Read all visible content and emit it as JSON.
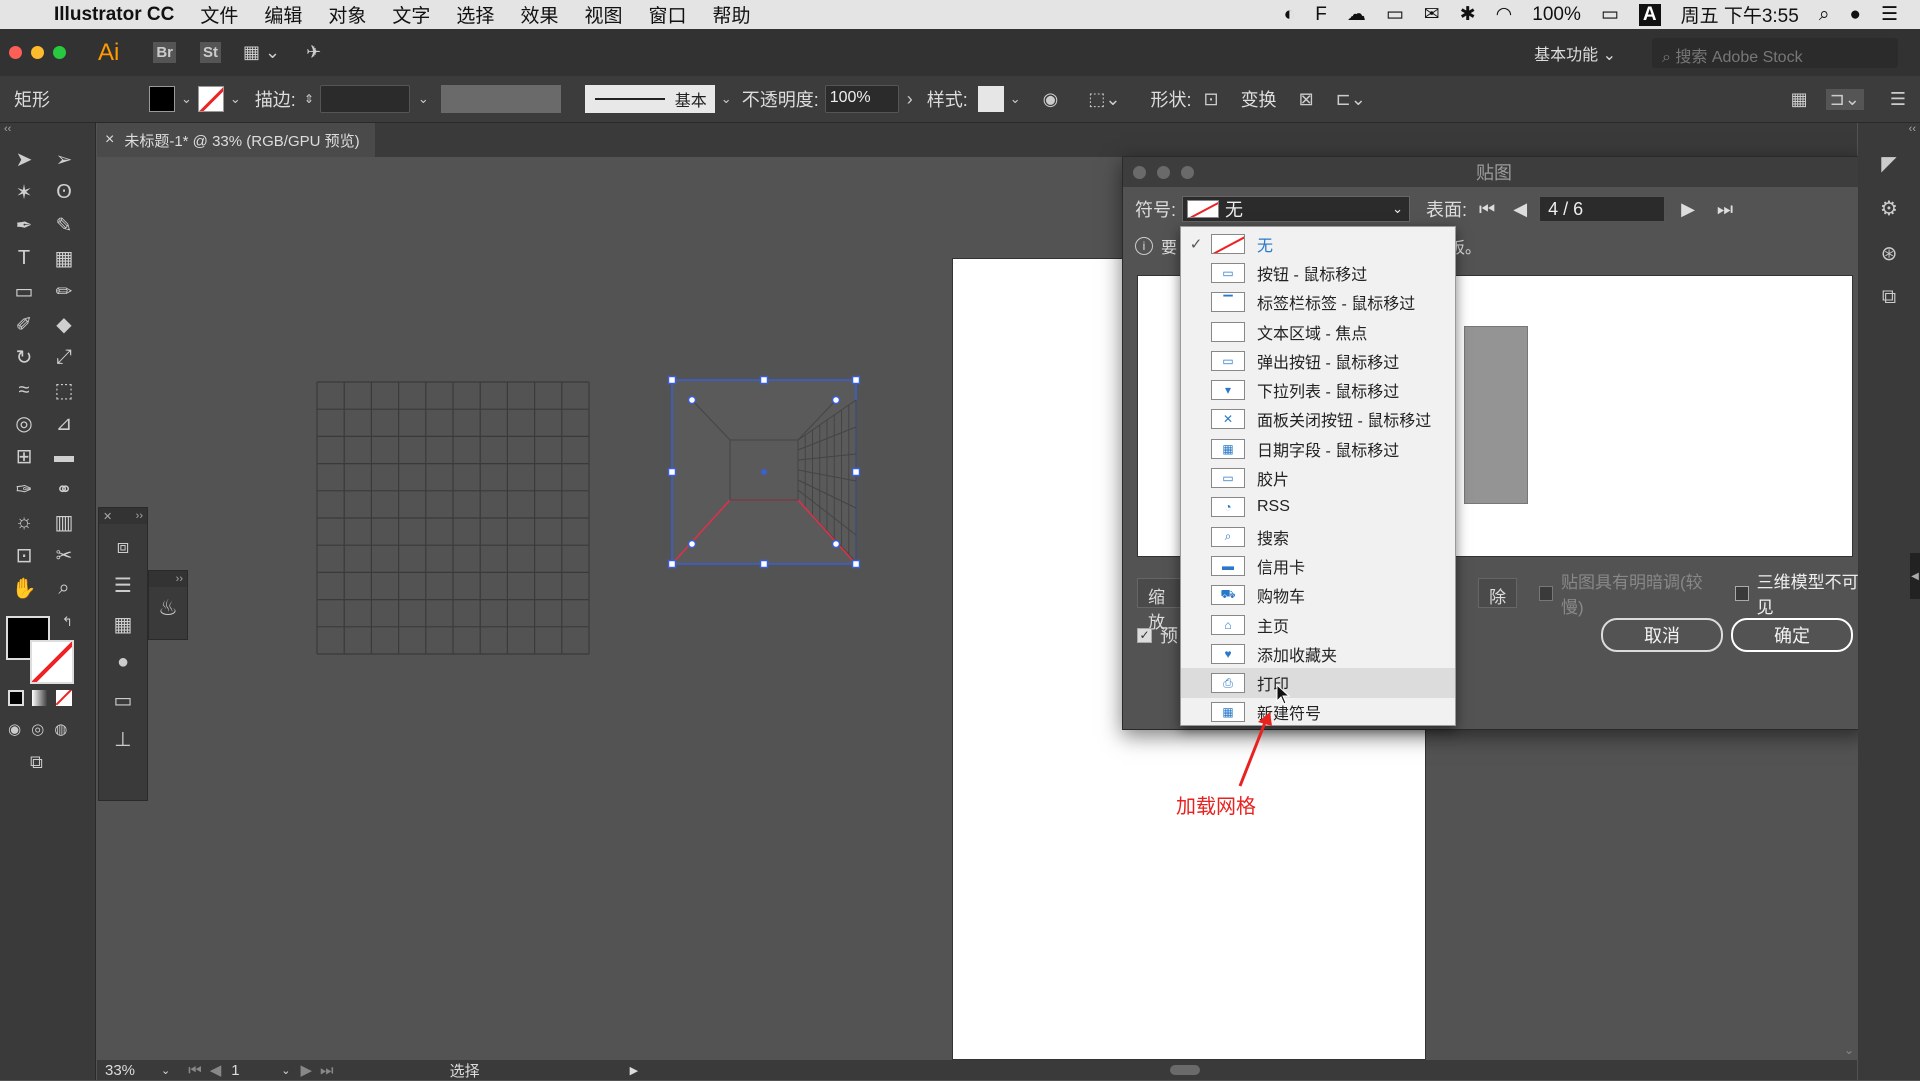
{
  "menubar": {
    "app_name": "Illustrator CC",
    "items": [
      "文件",
      "编辑",
      "对象",
      "文字",
      "选择",
      "效果",
      "视图",
      "窗口",
      "帮助"
    ],
    "battery": "100%",
    "input_method": "A",
    "datetime": "周五 下午3:55"
  },
  "appbar": {
    "logo": "Ai",
    "br": "Br",
    "st": "St",
    "workspace": "基本功能",
    "search_placeholder": "搜索 Adobe Stock"
  },
  "control": {
    "object_type": "矩形",
    "stroke_label": "描边:",
    "stroke_style": "基本",
    "opacity_label": "不透明度:",
    "opacity_value": "100%",
    "style_label": "样式:",
    "shape_label": "形状:",
    "transform_label": "变换"
  },
  "document_tab": {
    "title": "未标题-1* @ 33% (RGB/GPU 预览)",
    "close": "×"
  },
  "statusbar": {
    "zoom": "33%",
    "page": "1",
    "tool": "选择"
  },
  "dialog": {
    "title": "贴图",
    "symbol_label": "符号:",
    "symbol_value": "无",
    "surface_label": "表面:",
    "surface_value": "4 / 6",
    "info_left": "要",
    "info_right": "板。",
    "scale_btn": "缩放",
    "clear_btn": "除",
    "shade_checkbox": "贴图具有明暗调(较慢)",
    "invisible_checkbox": "三维模型不可见",
    "preview_checkbox": "预",
    "cancel": "取消",
    "ok": "确定"
  },
  "symbol_menu": {
    "items": [
      {
        "label": "无",
        "checked": true,
        "icon": "none-swatch-icon"
      },
      {
        "label": "按钮 - 鼠标移过",
        "icon": "button-icon"
      },
      {
        "label": "标签栏标签 - 鼠标移过",
        "icon": "tab-icon"
      },
      {
        "label": "文本区域 - 焦点",
        "icon": "textarea-icon"
      },
      {
        "label": "弹出按钮 - 鼠标移过",
        "icon": "popup-button-icon"
      },
      {
        "label": "下拉列表 - 鼠标移过",
        "icon": "dropdown-list-icon"
      },
      {
        "label": "面板关闭按钮 - 鼠标移过",
        "icon": "panel-close-icon"
      },
      {
        "label": "日期字段 - 鼠标移过",
        "icon": "date-field-icon"
      },
      {
        "label": "胶片",
        "icon": "film-icon"
      },
      {
        "label": "RSS",
        "icon": "rss-icon"
      },
      {
        "label": "搜索",
        "icon": "search-icon"
      },
      {
        "label": "信用卡",
        "icon": "credit-card-icon"
      },
      {
        "label": "购物车",
        "icon": "cart-icon"
      },
      {
        "label": "主页",
        "icon": "home-icon"
      },
      {
        "label": "添加收藏夹",
        "icon": "favorite-icon"
      },
      {
        "label": "打印",
        "icon": "print-icon",
        "highlighted": true
      },
      {
        "label": "新建符号",
        "icon": "new-symbol-icon"
      }
    ]
  },
  "annotation": {
    "text": "加载网格",
    "color": "#e8231f"
  }
}
